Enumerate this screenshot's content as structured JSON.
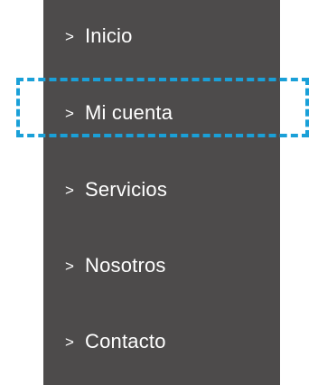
{
  "menu": {
    "items": [
      {
        "label": "Inicio",
        "chevron": ">"
      },
      {
        "label": "Mi cuenta",
        "chevron": ">"
      },
      {
        "label": "Servicios",
        "chevron": ">"
      },
      {
        "label": "Nosotros",
        "chevron": ">"
      },
      {
        "label": "Contacto",
        "chevron": ">"
      }
    ],
    "highlighted_item": "Mi cuenta"
  },
  "colors": {
    "menu_background": "#4d4b4b",
    "text": "#ffffff",
    "highlight_border": "#1aa0d8"
  }
}
